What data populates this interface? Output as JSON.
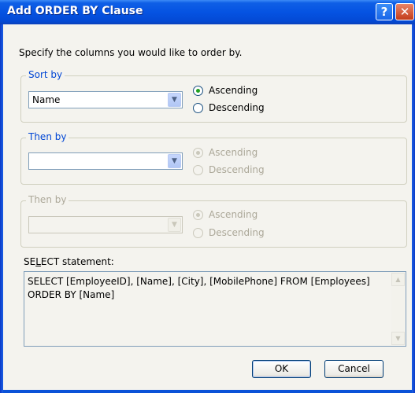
{
  "window": {
    "title": "Add ORDER BY Clause",
    "help_glyph": "?",
    "close_glyph": "✕"
  },
  "intro": "Specify the columns you would like to order by.",
  "groups": [
    {
      "legend": "Sort by",
      "value": "Name",
      "ascending": "Ascending",
      "descending": "Descending",
      "selected": "Ascending",
      "enabled": true
    },
    {
      "legend": "Then by",
      "value": "",
      "ascending": "Ascending",
      "descending": "Descending",
      "selected": "Ascending",
      "enabled": false
    },
    {
      "legend": "Then by",
      "value": "",
      "ascending": "Ascending",
      "descending": "Descending",
      "selected": "Ascending",
      "enabled": false
    }
  ],
  "select_statement": {
    "label_before": "SE",
    "label_underlined": "L",
    "label_after": "ECT statement:",
    "text": "SELECT [EmployeeID], [Name], [City], [MobilePhone] FROM [Employees]\nORDER BY [Name]"
  },
  "buttons": {
    "ok": "OK",
    "cancel": "Cancel"
  },
  "icons": {
    "dropdown": "chevron-down-icon",
    "scroll_up": "arrow-up-icon",
    "scroll_down": "arrow-down-icon"
  },
  "colors": {
    "title_bar": "#0553e2",
    "legend_active": "#0046d5",
    "disabled_text": "#aca899",
    "radio_dot": "#21a121"
  }
}
